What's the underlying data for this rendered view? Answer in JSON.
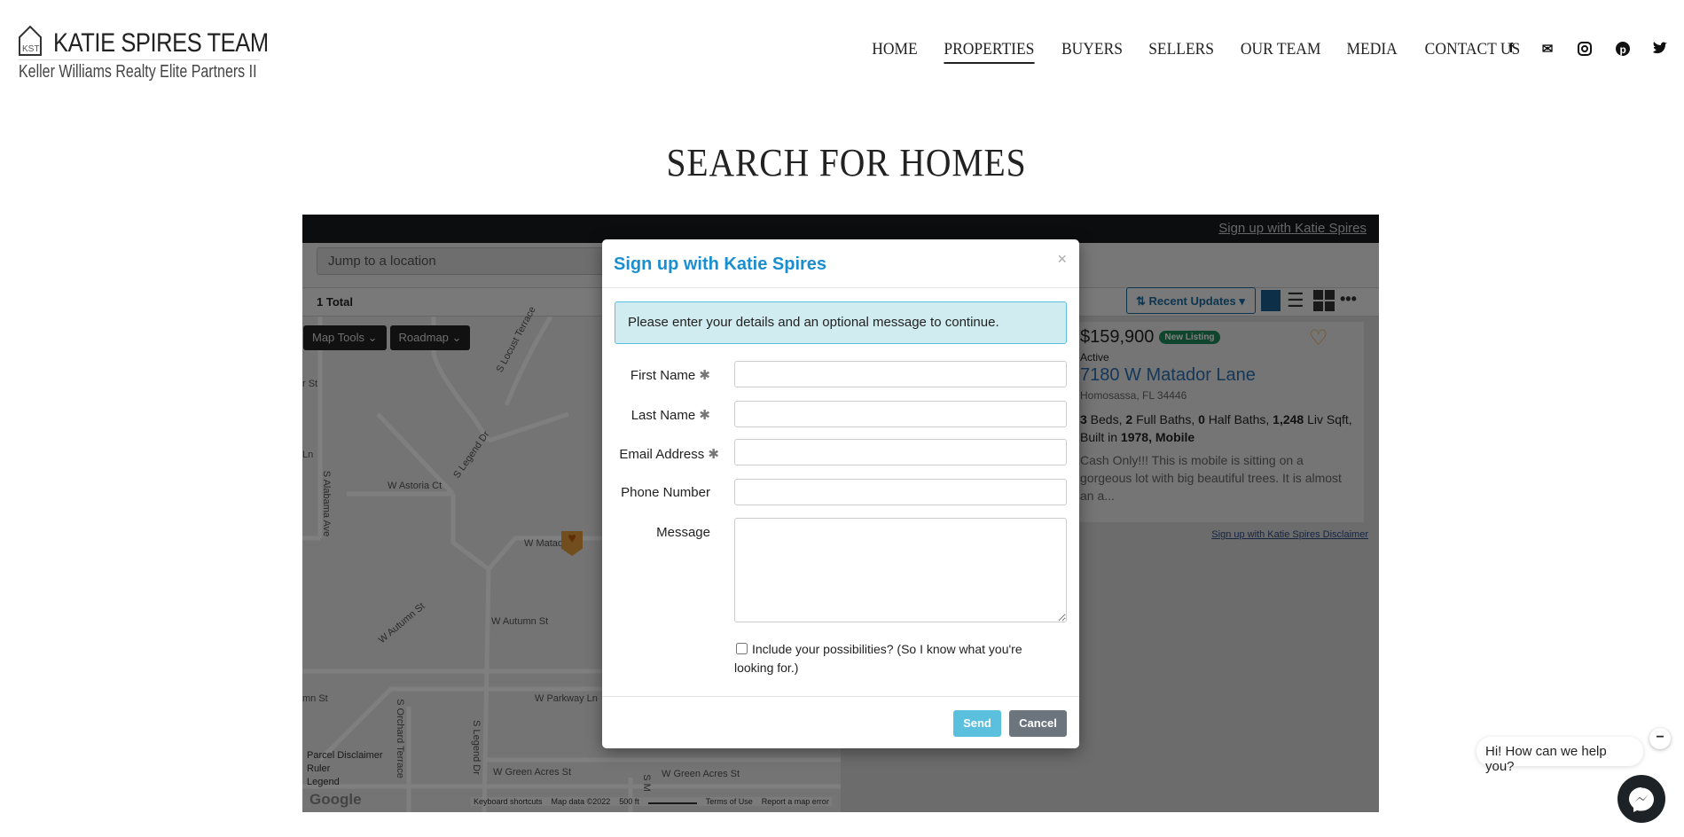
{
  "header": {
    "logo_title": "KATIE SPIRES TEAM",
    "logo_subtitle": "Keller Williams Realty Elite Partners II",
    "logo_mark": "KST",
    "nav": [
      "HOME",
      "PROPERTIES",
      "BUYERS",
      "SELLERS",
      "OUR TEAM",
      "MEDIA",
      "CONTACT US"
    ],
    "active_nav": "PROPERTIES",
    "social": [
      "facebook-icon",
      "mail-icon",
      "instagram-icon",
      "pinterest-icon",
      "twitter-icon"
    ]
  },
  "page_title": "SEARCH FOR HOMES",
  "idx": {
    "signup_link": "Sign up with Katie Spires",
    "search_placeholder": "Jump to a location",
    "total": "1 Total",
    "sort_label": "Recent Updates",
    "map_tools": "Map Tools",
    "roadmap": "Roadmap",
    "streets": [
      "S Locust Terrace",
      "S Legend Dr",
      "W Astoria Ct",
      "S Alabama Ave",
      "W Matador",
      "W Autumn St",
      "W Autumn St",
      "W Parkway Ln",
      "S Orchard Terrace",
      "S Legend Dr",
      "W Green Acres St",
      "W Green Acres St",
      "r St",
      "Ln",
      "mn St",
      "S M"
    ],
    "map_links": [
      "Parcel Disclaimer",
      "Ruler",
      "Legend"
    ],
    "map_footer": [
      "Keyboard shortcuts",
      "Map data ©2022",
      "500 ft",
      "Terms of Use",
      "Report a map error"
    ],
    "google": "Google",
    "listing": {
      "price": "$159,900",
      "badge": "New Listing",
      "status": "Active",
      "address": "7180 W Matador Lane",
      "city": "Homosassa, FL 34446",
      "beds": "3",
      "baths_full": "2",
      "baths_half": "0",
      "sqft": "1,248",
      "year": "1978",
      "type": "Mobile",
      "desc": "Cash Only!!! This is mobile is sitting on a gorgeous lot with big beautiful trees. It is almost an a..."
    },
    "footer_links": [
      "Sign up with Katie Spires",
      "Disclaimer"
    ]
  },
  "modal": {
    "title": "Sign up with Katie Spires",
    "close": "×",
    "alert": "Please enter your details and an optional message to continue.",
    "fields": [
      {
        "label": "First Name",
        "required": true,
        "value": ""
      },
      {
        "label": "Last Name",
        "required": true,
        "value": ""
      },
      {
        "label": "Email Address",
        "required": true,
        "value": ""
      },
      {
        "label": "Phone Number",
        "required": false,
        "value": ""
      }
    ],
    "message_label": "Message",
    "checkbox_label": "Include your possibilities? (So I know what you're looking for.)",
    "checkbox_checked": false,
    "send": "Send",
    "cancel": "Cancel"
  },
  "chat": {
    "greeting": "Hi! How can we help you?",
    "minimize": "−"
  },
  "colors": {
    "modal_title": "#1a8fd0",
    "send": "#5bc0de",
    "cancel": "#6c757d",
    "badge": "#1e8a5a",
    "link": "#2a6fb0"
  }
}
